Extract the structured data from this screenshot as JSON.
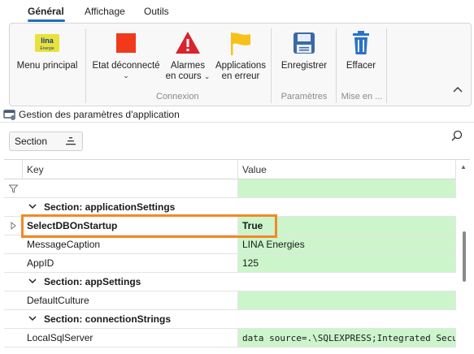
{
  "tabs": [
    "Général",
    "Affichage",
    "Outils"
  ],
  "ribbon": {
    "buttons": {
      "menu": "Menu principal",
      "etat": "Etat déconnecté",
      "alarmes_1": "Alarmes",
      "alarmes_2": "en cours",
      "apps_1": "Applications",
      "apps_2": "en erreur",
      "enregistrer": "Enregistrer",
      "effacer": "Effacer"
    },
    "logo_text_1": "lina",
    "logo_text_2": "Énergie",
    "groups": {
      "connexion": "Connexion",
      "parametres": "Paramètres",
      "mise_en": "Mise en ..."
    },
    "colors": {
      "status_red": "#f03a1a",
      "alert_red": "#d9232d",
      "flag_yellow": "#f6c21a",
      "save_blue": "#3a6aa8",
      "trash_blue": "#2a72c8"
    }
  },
  "window_title": "Gestion des paramètres d'application",
  "toolbar": {
    "section_label": "Section"
  },
  "grid": {
    "headers": {
      "key": "Key",
      "value": "Value"
    },
    "sections": [
      "Section: applicationSettings",
      "Section: appSettings",
      "Section: connectionStrings"
    ],
    "rows": [
      {
        "key": "SelectDBOnStartup",
        "value": "True"
      },
      {
        "key": "MessageCaption",
        "value": "LINA Energies"
      },
      {
        "key": "AppID",
        "value": "125"
      },
      {
        "key": "DefaultCulture",
        "value": ""
      },
      {
        "key": "LocalSqlServer",
        "value": "data source=.\\SQLEXPRESS;Integrated Security=S..."
      }
    ],
    "highlight_color": "#f08a24",
    "value_bg": "#ccf5cc"
  }
}
